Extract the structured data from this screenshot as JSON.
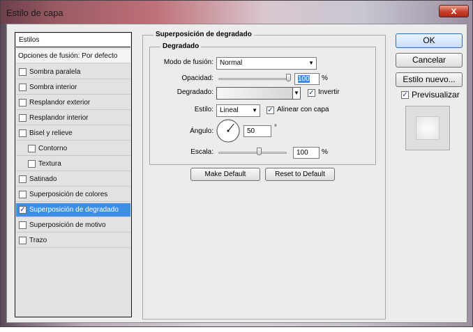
{
  "window": {
    "title": "Estilo de capa",
    "close_label": "x"
  },
  "sidebar": {
    "header": "Estilos",
    "blend_options": "Opciones de fusión: Por defecto",
    "items": [
      {
        "label": "Sombra paralela",
        "checked": false
      },
      {
        "label": "Sombra interior",
        "checked": false
      },
      {
        "label": "Resplandor exterior",
        "checked": false
      },
      {
        "label": "Resplandor interior",
        "checked": false
      },
      {
        "label": "Bisel y relieve",
        "checked": false
      },
      {
        "label": "Contorno",
        "checked": false
      },
      {
        "label": "Textura",
        "checked": false
      },
      {
        "label": "Satinado",
        "checked": false
      },
      {
        "label": "Superposición de colores",
        "checked": false
      },
      {
        "label": "Superposición de degradado",
        "checked": true
      },
      {
        "label": "Superposición de motivo",
        "checked": false
      },
      {
        "label": "Trazo",
        "checked": false
      }
    ]
  },
  "panel": {
    "outer_title": "Superposición de degradado",
    "inner_title": "Degradado",
    "blend_mode_label": "Modo de fusión:",
    "blend_mode_value": "Normal",
    "opacity_label": "Opacidad:",
    "opacity_value": "100",
    "percent": "%",
    "gradient_label": "Degradado:",
    "invert_label": "Invertir",
    "style_label": "Estilo:",
    "style_value": "Lineal",
    "align_label": "Alinear con capa",
    "angle_label": "Ángulo:",
    "angle_value": "50",
    "degree": "°",
    "scale_label": "Escala:",
    "scale_value": "100",
    "make_default": "Make Default",
    "reset_default": "Reset to Default"
  },
  "actions": {
    "ok": "OK",
    "cancel": "Cancelar",
    "new_style": "Estilo nuevo...",
    "preview_label": "Previsualizar"
  },
  "values": {
    "opacity_level": 100,
    "scale_level": 100,
    "angle_degrees": 50
  },
  "icons": {
    "check": "✓",
    "arrow": "▼"
  },
  "colors": {
    "selected": "#3d8ee6",
    "close": "#c8402a"
  }
}
